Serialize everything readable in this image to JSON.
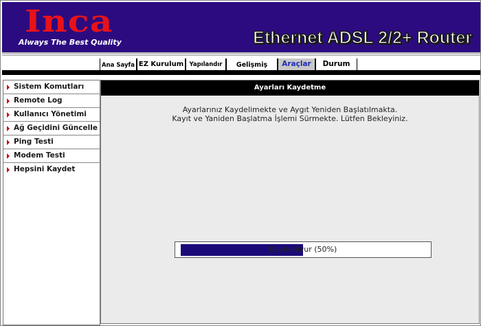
{
  "header": {
    "logo": "Inca",
    "tagline": "Always The Best Quality",
    "product": "Ethernet ADSL 2/2+ Router"
  },
  "tabs": [
    {
      "label": "Ana Sayfa",
      "active": false
    },
    {
      "label": "EZ Kurulum",
      "active": false
    },
    {
      "label": "Yapılandır",
      "active": false
    },
    {
      "label": "Gelişmiş",
      "active": false
    },
    {
      "label": "Araçlar",
      "active": true
    },
    {
      "label": "Durum",
      "active": false
    }
  ],
  "sidebar": {
    "items": [
      {
        "label": "Sistem Komutları"
      },
      {
        "label": "Remote Log"
      },
      {
        "label": "Kullanıcı Yönetimi"
      },
      {
        "label": "Ağ Geçidini Güncelle"
      },
      {
        "label": "Ping Testi"
      },
      {
        "label": "Modem Testi"
      },
      {
        "label": "Hepsini Kaydet"
      }
    ]
  },
  "content": {
    "title": "Ayarları Kaydetme",
    "message_line1": "Ayarlarınız Kaydelimekte ve Aygıt Yeniden Başlatılmakta.",
    "message_line2": "Kayıt ve Yaniden Başlatma İşlemi Sürmekte. Lütfen Bekleyiniz.",
    "progress_label": "Kaydediyur (50%)",
    "progress_fraction": 0.5
  },
  "colors": {
    "header_bg": "#2c0b80",
    "logo": "#e8121a",
    "active_tab_text": "#1d2bb0",
    "progress_fill": "#1a0a78"
  },
  "icons": {
    "sidebar_bullet": "red-triangle-right"
  }
}
